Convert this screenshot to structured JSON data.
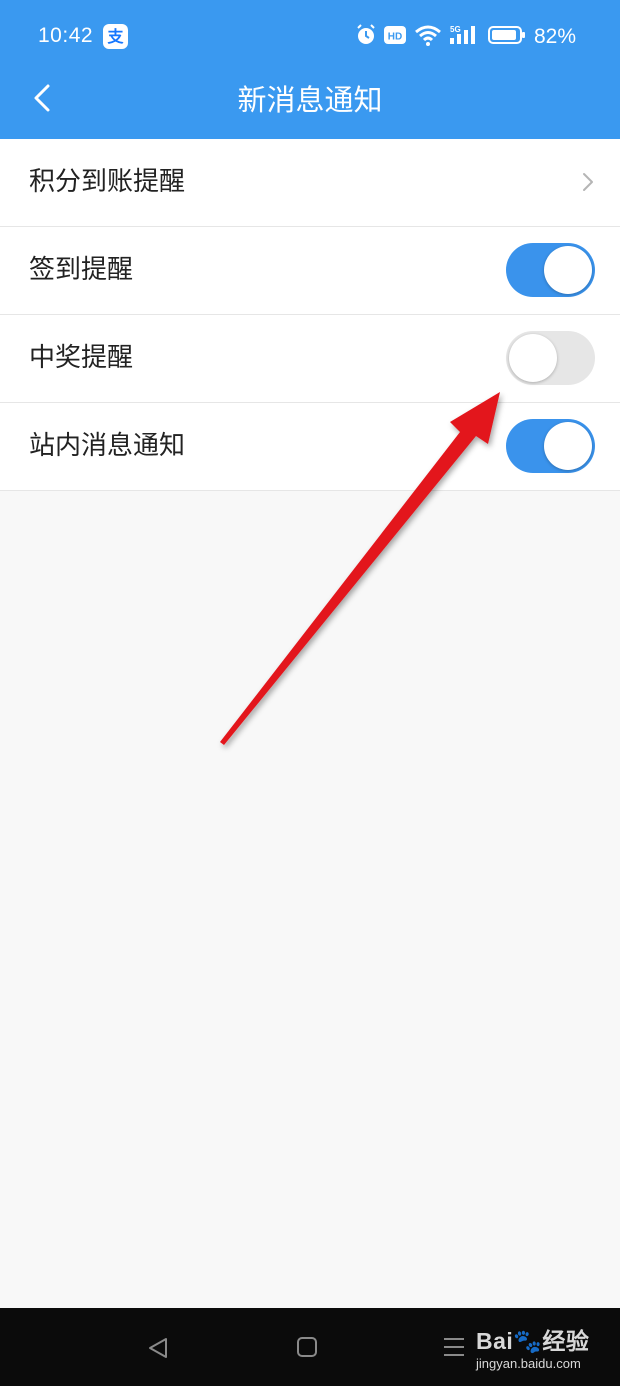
{
  "status_bar": {
    "time": "10:42",
    "app_badge": "支",
    "battery": "82%"
  },
  "nav": {
    "title": "新消息通知"
  },
  "settings": [
    {
      "label": "积分到账提醒",
      "control": "chevron"
    },
    {
      "label": "签到提醒",
      "control": "toggle",
      "enabled": true
    },
    {
      "label": "中奖提醒",
      "control": "toggle",
      "enabled": false
    },
    {
      "label": "站内消息通知",
      "control": "toggle",
      "enabled": true
    }
  ],
  "watermark": {
    "logo": "Bai🐾经验",
    "url": "jingyan.baidu.com"
  },
  "colors": {
    "header": "#3a99f0",
    "toggle_on": "#3a93ec",
    "toggle_off": "#e6e6e6",
    "annotation_arrow": "#e3131b"
  }
}
